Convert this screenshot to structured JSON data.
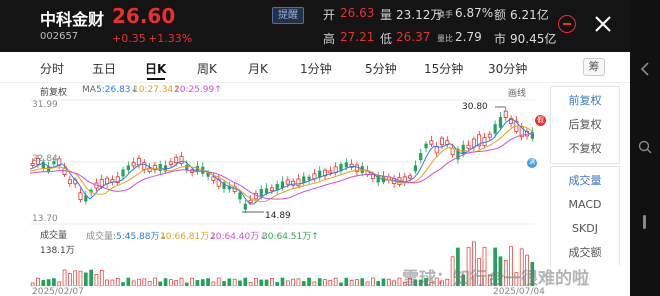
{
  "header": {
    "stock_name": "中科金财",
    "stock_code": "002657",
    "price": "26.60",
    "change": "+0.35",
    "change_pct": "+1.33%",
    "alert_label": "提醒",
    "open_label": "开",
    "open_value": "26.63",
    "volume_label": "量",
    "volume_value": "23.12万",
    "turnover_label": "换手",
    "turnover_value": "6.87%",
    "amount_label": "额",
    "amount_value": "6.21亿",
    "high_label": "高",
    "high_value": "27.21",
    "low_label": "低",
    "low_value": "26.37",
    "volratio_label": "量比",
    "volratio_value": "2.79",
    "mktcap_label": "市",
    "mktcap_value": "90.45亿"
  },
  "tabs": [
    "分时",
    "五日",
    "日K",
    "周K",
    "月K",
    "1分钟",
    "5分钟",
    "15分钟",
    "30分钟"
  ],
  "active_tab": "日K",
  "chip_button": "筹",
  "main_chart": {
    "adjust_label": "前复权",
    "ma_prefix": "MA",
    "ma5": "5:26.83↓",
    "ma10": "10:27.34↑",
    "ma20": "20:25.99↑",
    "draw_label": "画线",
    "y_top": "31.99",
    "y_mid": "22.84",
    "y_bot": "13.70",
    "high_mark": "30.80",
    "low_mark": "14.89",
    "badge_hold": "假",
    "badge_sub": "满"
  },
  "volume_chart": {
    "title": "成交量",
    "vol_label": "成交量:",
    "ma5": "5:45.88万↓",
    "ma10": "10:66.81万↓",
    "ma20": "20:64.40万↓",
    "ma30": "30:64.51万↑",
    "y_max": "138.1万",
    "date_start": "2025/02/07",
    "date_end": "2025/07/04"
  },
  "right_panel": {
    "adjust_options": [
      "前复权",
      "后复权",
      "不复权"
    ],
    "indicator_options": [
      "成交量",
      "MACD",
      "SKDJ",
      "成交额"
    ]
  },
  "watermark": "雪球：知行合一很难的啦",
  "colors": {
    "up": "#e8302c",
    "down": "#20a35a",
    "ma5": "#2b7de9",
    "ma10": "#e3a21a",
    "ma20": "#d54fd0",
    "ma30": "#2fa84f"
  }
}
